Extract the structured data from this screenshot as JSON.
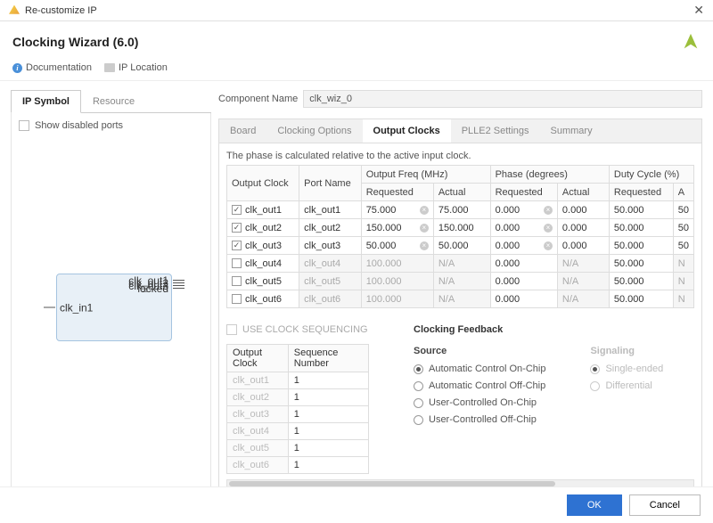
{
  "titlebar": {
    "title": "Re-customize IP"
  },
  "header": {
    "title": "Clocking Wizard (6.0)"
  },
  "toolbar": {
    "documentation": "Documentation",
    "ip_location": "IP Location"
  },
  "left": {
    "tabs": [
      "IP Symbol",
      "Resource"
    ],
    "show_disabled_label": "Show disabled ports",
    "block": {
      "in": "clk_in1",
      "outs": [
        "clk_out1",
        "clk_out2",
        "clk_out3",
        "locked"
      ]
    }
  },
  "component_name": {
    "label": "Component Name",
    "value": "clk_wiz_0"
  },
  "right_tabs": [
    "Board",
    "Clocking Options",
    "Output Clocks",
    "PLLE2 Settings",
    "Summary"
  ],
  "phase_note": "The phase is calculated relative to the active input clock.",
  "table": {
    "group_headers": [
      "Output Clock",
      "Port Name",
      "Output Freq (MHz)",
      "Phase (degrees)",
      "Duty Cycle (%)"
    ],
    "sub_headers": [
      "Requested",
      "Actual",
      "Requested",
      "Actual",
      "Requested",
      "A"
    ],
    "rows": [
      {
        "enabled": true,
        "clock": "clk_out1",
        "port": "clk_out1",
        "freq_req": "75.000",
        "freq_act": "75.000",
        "phase_req": "0.000",
        "phase_act": "0.000",
        "duty_req": "50.000",
        "du": "50"
      },
      {
        "enabled": true,
        "clock": "clk_out2",
        "port": "clk_out2",
        "freq_req": "150.000",
        "freq_act": "150.000",
        "phase_req": "0.000",
        "phase_act": "0.000",
        "duty_req": "50.000",
        "du": "50"
      },
      {
        "enabled": true,
        "clock": "clk_out3",
        "port": "clk_out3",
        "freq_req": "50.000",
        "freq_act": "50.000",
        "phase_req": "0.000",
        "phase_act": "0.000",
        "duty_req": "50.000",
        "du": "50"
      },
      {
        "enabled": false,
        "clock": "clk_out4",
        "port": "clk_out4",
        "freq_req": "100.000",
        "freq_act": "N/A",
        "phase_req": "0.000",
        "phase_act": "N/A",
        "duty_req": "50.000",
        "du": "N"
      },
      {
        "enabled": false,
        "clock": "clk_out5",
        "port": "clk_out5",
        "freq_req": "100.000",
        "freq_act": "N/A",
        "phase_req": "0.000",
        "phase_act": "N/A",
        "duty_req": "50.000",
        "du": "N"
      },
      {
        "enabled": false,
        "clock": "clk_out6",
        "port": "clk_out6",
        "freq_req": "100.000",
        "freq_act": "N/A",
        "phase_req": "0.000",
        "phase_act": "N/A",
        "duty_req": "50.000",
        "du": "N"
      }
    ]
  },
  "sequencing": {
    "checkbox_label": "USE CLOCK SEQUENCING",
    "headers": [
      "Output Clock",
      "Sequence Number"
    ],
    "rows": [
      {
        "clock": "clk_out1",
        "seq": "1"
      },
      {
        "clock": "clk_out2",
        "seq": "1"
      },
      {
        "clock": "clk_out3",
        "seq": "1"
      },
      {
        "clock": "clk_out4",
        "seq": "1"
      },
      {
        "clock": "clk_out5",
        "seq": "1"
      },
      {
        "clock": "clk_out6",
        "seq": "1"
      }
    ]
  },
  "feedback": {
    "title": "Clocking Feedback",
    "source_label": "Source",
    "signaling_label": "Signaling",
    "source_options": [
      "Automatic Control On-Chip",
      "Automatic Control Off-Chip",
      "User-Controlled On-Chip",
      "User-Controlled Off-Chip"
    ],
    "signaling_options": [
      "Single-ended",
      "Differential"
    ]
  },
  "footer": {
    "ok": "OK",
    "cancel": "Cancel"
  }
}
